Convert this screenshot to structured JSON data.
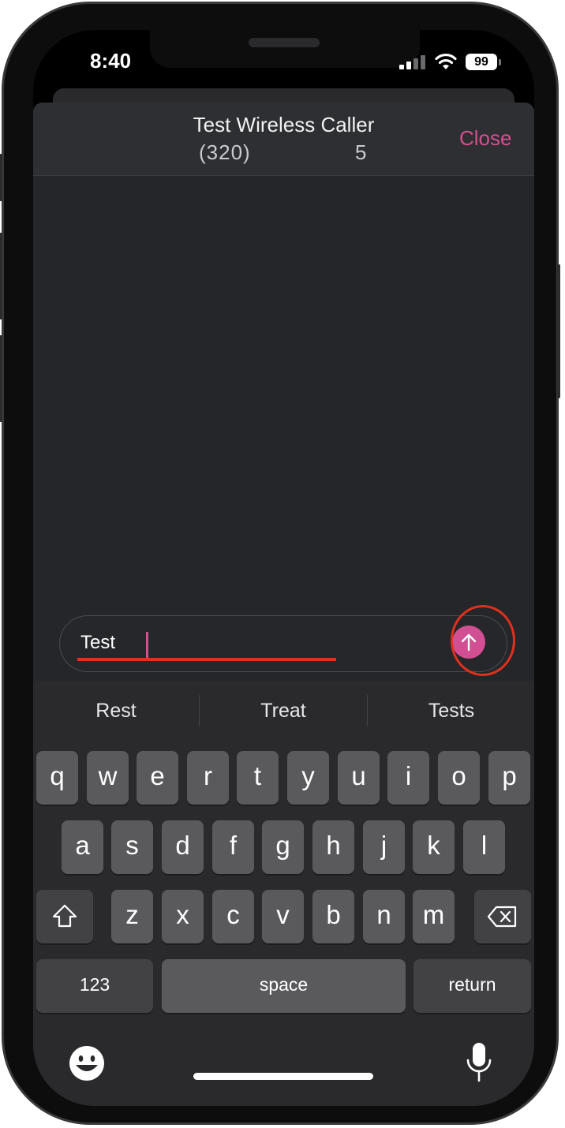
{
  "status_bar": {
    "time": "8:40",
    "battery": "99",
    "icons": [
      "cellular-signal-icon",
      "wifi-icon",
      "battery-icon"
    ]
  },
  "header": {
    "title": "Test Wireless Caller",
    "number": "(320)",
    "count": "5",
    "close_label": "Close"
  },
  "composer": {
    "value": "Test",
    "send_icon": "arrow-up-icon"
  },
  "suggestions": [
    "Rest",
    "Treat",
    "Tests"
  ],
  "keyboard": {
    "row1": [
      "q",
      "w",
      "e",
      "r",
      "t",
      "y",
      "u",
      "i",
      "o",
      "p"
    ],
    "row2": [
      "a",
      "s",
      "d",
      "f",
      "g",
      "h",
      "j",
      "k",
      "l"
    ],
    "row3": [
      "z",
      "x",
      "c",
      "v",
      "b",
      "n",
      "m"
    ],
    "numbers_label": "123",
    "space_label": "space",
    "return_label": "return",
    "shift_icon": "shift-icon",
    "delete_icon": "delete-icon",
    "emoji_icon": "emoji-icon",
    "mic_icon": "microphone-icon"
  },
  "colors": {
    "accent": "#d3508f",
    "annotation": "#e0301e",
    "background": "#252629"
  }
}
